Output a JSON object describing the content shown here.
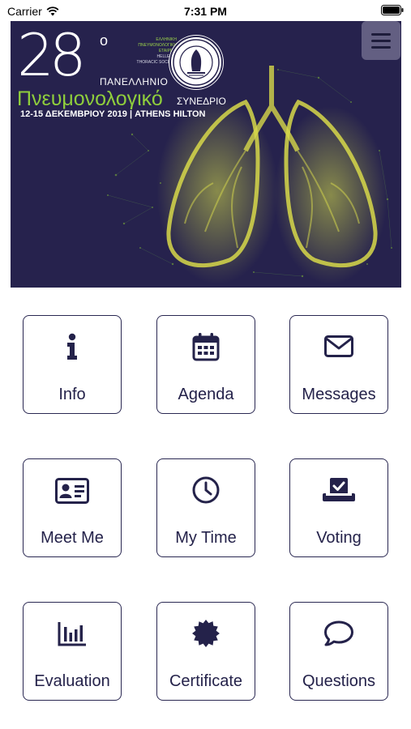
{
  "status_bar": {
    "carrier": "Carrier",
    "time": "7:31 PM"
  },
  "banner": {
    "number": "28",
    "ordinal": "ο",
    "society_lines": [
      "ΕΛΛΗΝΙΚΗ",
      "ΠΝΕΥΜΟΝΟΛΟΓΙΚΗ",
      "ΕΤΑΙΡΕΙΑ",
      "HELLENIC",
      "THORACIC SOCIETY"
    ],
    "title_line1": "ΠΑΝΕΛΛΗΝΙΟ",
    "title_line2": "Πνευμονολογικό",
    "title_line2b": "ΣΥΝΕΔΡΙΟ",
    "date_venue": "12-15 ΔΕΚΕΜΒΡΙΟΥ 2019  |  ATHENS HILTON"
  },
  "tiles": [
    {
      "label": "Info",
      "icon": "info-icon"
    },
    {
      "label": "Agenda",
      "icon": "calendar-icon"
    },
    {
      "label": "Messages",
      "icon": "envelope-icon"
    },
    {
      "label": "Meet Me",
      "icon": "id-card-icon"
    },
    {
      "label": "My Time",
      "icon": "clock-icon"
    },
    {
      "label": "Voting",
      "icon": "ballot-box-icon"
    },
    {
      "label": "Evaluation",
      "icon": "bar-chart-icon"
    },
    {
      "label": "Certificate",
      "icon": "certificate-icon"
    },
    {
      "label": "Questions",
      "icon": "speech-bubble-icon"
    }
  ],
  "colors": {
    "navy": "#26224d",
    "accent_green": "#8fce3c",
    "tile_border": "#2a2852"
  }
}
